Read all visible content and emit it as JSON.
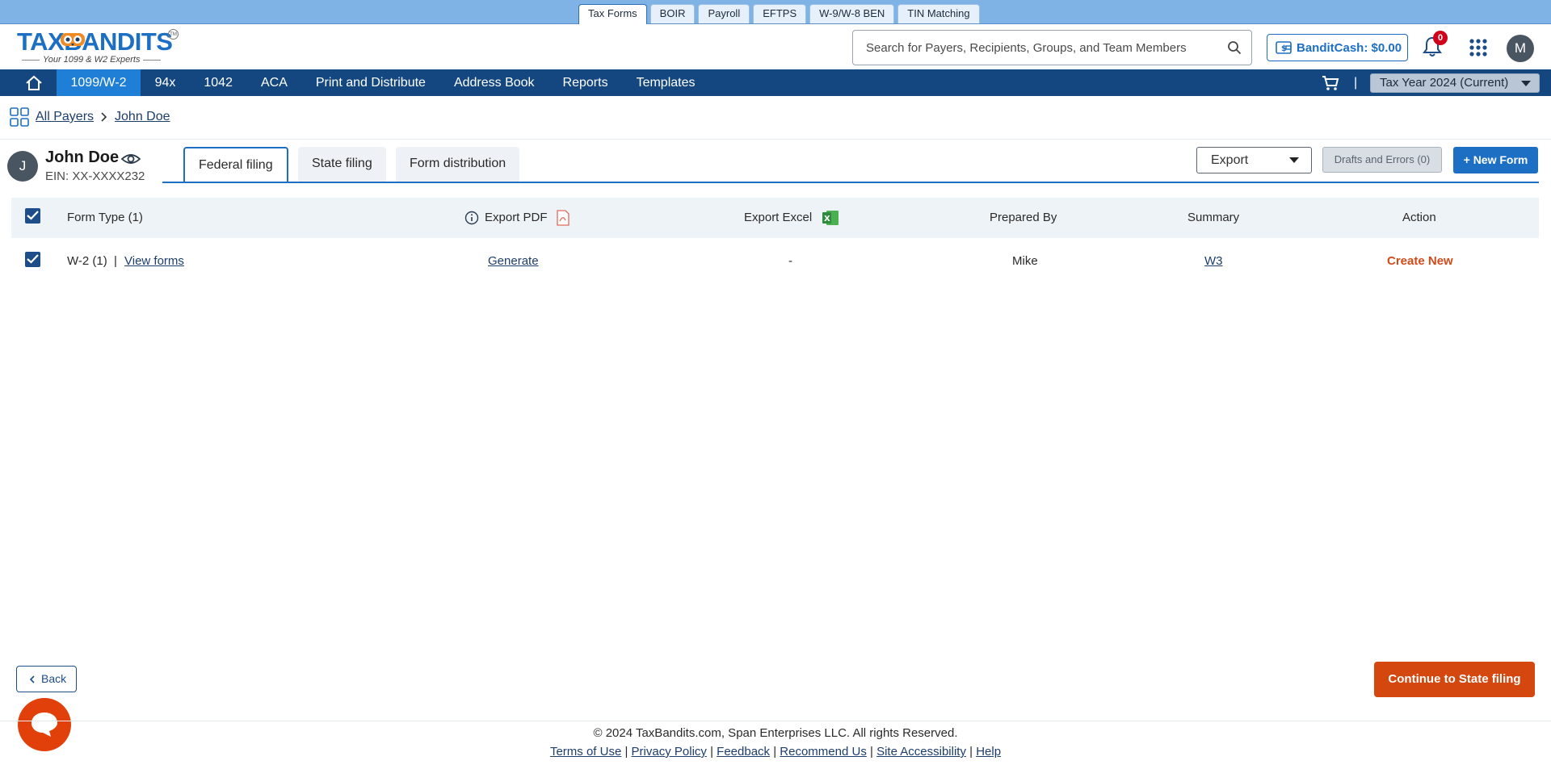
{
  "product_tabs": [
    {
      "label": "Tax Forms",
      "active": true
    },
    {
      "label": "BOIR"
    },
    {
      "label": "Payroll"
    },
    {
      "label": "EFTPS"
    },
    {
      "label": "W-9/W-8 BEN"
    },
    {
      "label": "TIN Matching"
    }
  ],
  "logo": {
    "text": "TAXBANDITS",
    "tagline": "Your 1099 & W2 Experts",
    "tm": "TM"
  },
  "search": {
    "placeholder": "Search for Payers, Recipients, Groups, and Team Members",
    "value": ""
  },
  "bandit_cash": {
    "label": "BanditCash: $0.00"
  },
  "notifications": {
    "count": "0"
  },
  "user": {
    "initial": "M"
  },
  "nav": {
    "items": [
      {
        "label": "1099/W-2",
        "active": true
      },
      {
        "label": "94x"
      },
      {
        "label": "1042"
      },
      {
        "label": "ACA"
      },
      {
        "label": "Print and Distribute"
      },
      {
        "label": "Address Book"
      },
      {
        "label": "Reports"
      },
      {
        "label": "Templates"
      }
    ],
    "separator": "|",
    "tax_year": "Tax Year 2024 (Current)"
  },
  "breadcrumb": {
    "all_payers": "All Payers",
    "current": "John Doe"
  },
  "payer": {
    "initial": "J",
    "name": "John Doe",
    "ein": "EIN: XX-XXXX232"
  },
  "tabs": [
    {
      "label": "Federal filing",
      "active": true
    },
    {
      "label": "State filing"
    },
    {
      "label": "Form distribution"
    }
  ],
  "actions": {
    "export": "Export",
    "drafts": "Drafts and Errors (0)",
    "new_form": "+ New Form"
  },
  "table": {
    "headers": {
      "form_type": "Form Type  (1)",
      "export_pdf": "Export PDF",
      "export_excel": "Export Excel",
      "prepared_by": "Prepared By",
      "summary": "Summary",
      "action": "Action"
    },
    "rows": [
      {
        "form": "W-2 (1)",
        "sep": "|",
        "view": "View forms",
        "pdf": "Generate",
        "excel": "-",
        "prepared_by": "Mike",
        "summary": "W3",
        "action": "Create New"
      }
    ]
  },
  "buttons": {
    "back": "Back",
    "continue": "Continue to State filing"
  },
  "footer": {
    "copyright": "© 2024 TaxBandits.com, Span Enterprises LLC. All rights Reserved.",
    "links": [
      "Terms of Use",
      "Privacy Policy",
      "Feedback",
      "Recommend Us",
      "Site Accessibility",
      "Help"
    ],
    "sep": "|"
  },
  "colors": {
    "brand_blue": "#1d6fc4",
    "nav_dark": "#14477f",
    "accent_orange": "#d4470f"
  }
}
